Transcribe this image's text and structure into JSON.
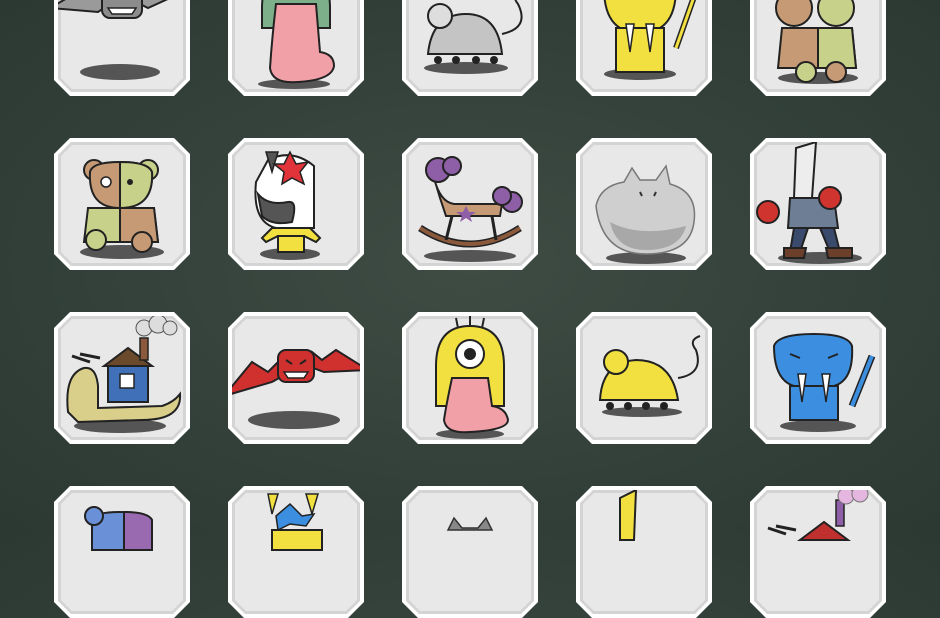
{
  "colors": {
    "background": "#36443d",
    "card_border": "#ffffff",
    "card_fill": "#e8e8e8"
  },
  "grid": {
    "rows": [
      [
        "bat-monster",
        "tongue-cyclops-green",
        "gray-windup-mouse",
        "yellow-sabertooth-tiger",
        "patched-teddy-bear"
      ],
      [
        "patched-teddy-bear",
        "zebra-unicorn",
        "rocking-horse",
        "fluffy-white-cat",
        "boxing-robot"
      ],
      [
        "house-snail",
        "red-bat-monster",
        "tongue-cyclops-yellow",
        "yellow-windup-mouse",
        "blue-sabertooth-tiger"
      ],
      [
        "blue-teddy-bear",
        "blue-zebra-unicorn",
        "gray-cat",
        "yellow-boxing-robot",
        "house-snail"
      ]
    ]
  }
}
